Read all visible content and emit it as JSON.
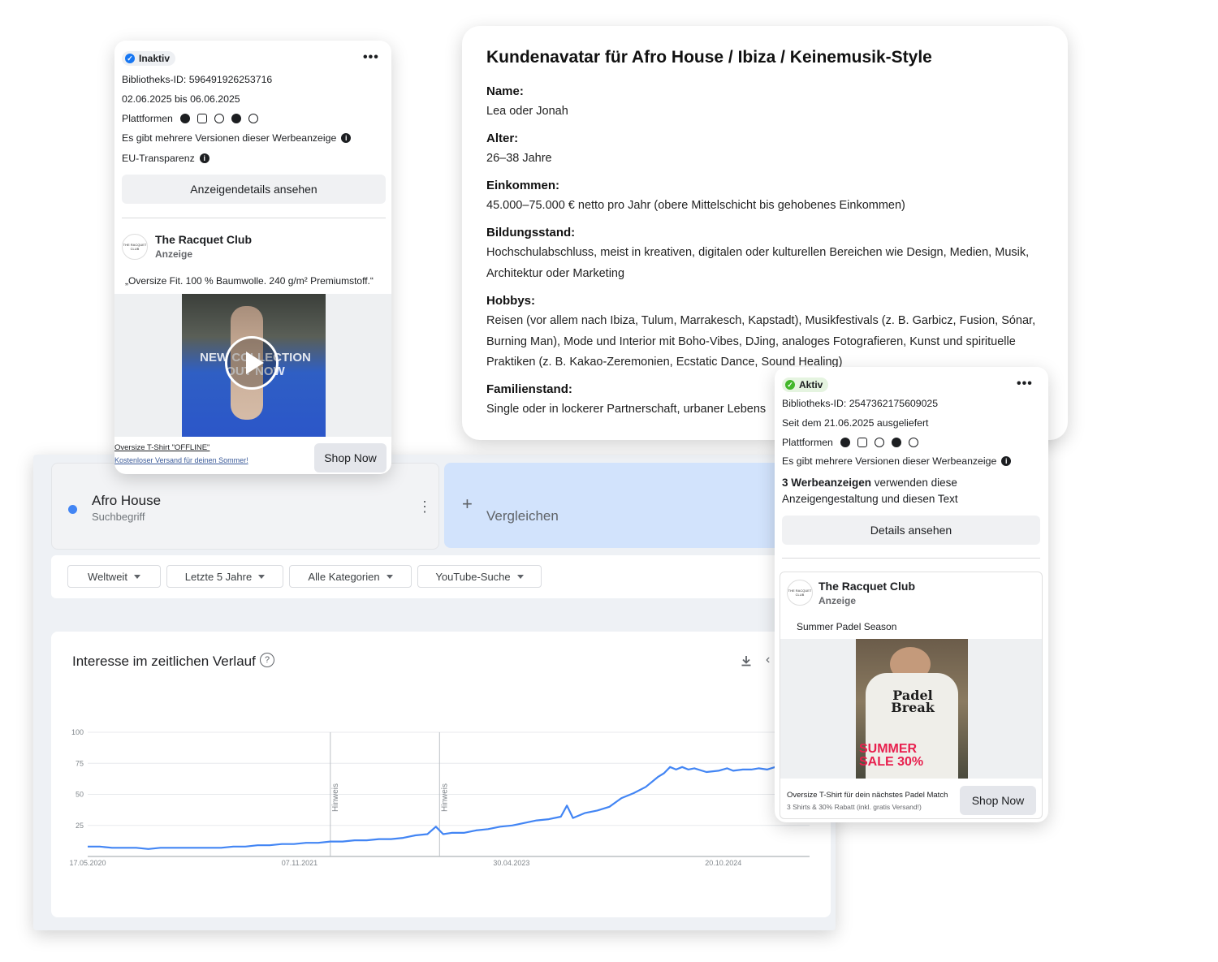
{
  "avatar": {
    "title": "Kundenavatar für Afro House / Ibiza / Keinemusik-Style",
    "fields": [
      {
        "label": "Name:",
        "text": "Lea oder Jonah"
      },
      {
        "label": "Alter:",
        "text": "26–38 Jahre"
      },
      {
        "label": "Einkommen:",
        "text": "45.000–75.000 € netto pro Jahr (obere Mittelschicht bis gehobenes Einkommen)"
      },
      {
        "label": "Bildungsstand:",
        "text": "Hochschulabschluss, meist in kreativen, digitalen oder kulturellen Bereichen wie Design, Medien, Musik, Architektur oder Marketing"
      },
      {
        "label": "Hobbys:",
        "text": "Reisen (vor allem nach Ibiza, Tulum, Marrakesch, Kapstadt), Musikfestivals (z. B. Garbicz, Fusion, Sónar, Burning Man), Mode und Interior mit Boho-Vibes, DJing, analoges Fotografieren, Kunst und spirituelle Praktiken (z. B. Kakao-Zeremonien, Ecstatic Dance, Sound Healing)"
      },
      {
        "label": "Familienstand:",
        "text": "Single oder in lockerer Partnerschaft, urbaner Lebens"
      }
    ]
  },
  "ad_inactive": {
    "status": "Inaktiv",
    "library_id": "Bibliotheks-ID: 596491926253716",
    "dates": "02.06.2025 bis 06.06.2025",
    "platforms_label": "Plattformen",
    "versions_note": "Es gibt mehrere Versionen dieser Werbeanzeige",
    "eu_label": "EU-Transparenz",
    "details_button": "Anzeigendetails ansehen",
    "brand": "The Racquet Club",
    "brand_sub": "Anzeige",
    "logo_text": "THE RACQUET CLUB",
    "copy": "„Oversize Fit. 100 % Baumwolle. 240 g/m² Premiumstoff.“",
    "video_overlay": "NEW COLLECTION OUT NOW",
    "footer_title": "Oversize T-Shirt \"OFFLINE\"",
    "footer_sub": "Kostenloser Versand für deinen Sommer!",
    "cta": "Shop Now",
    "color_status": "#1877f2"
  },
  "ad_active": {
    "status": "Aktiv",
    "library_id": "Bibliotheks-ID: 2547362175609025",
    "since": "Seit dem 21.06.2025 ausgeliefert",
    "platforms_label": "Plattformen",
    "versions_note": "Es gibt mehrere Versionen dieser Werbeanzeige",
    "usage_bold": "3 Werbeanzeigen",
    "usage_rest": " verwenden diese",
    "usage_line2": "Anzeigengestaltung und diesen Text",
    "details_button": "Details ansehen",
    "brand": "The Racquet Club",
    "brand_sub": "Anzeige",
    "logo_text": "THE RACQUET CLUB",
    "copy": "Summer Padel Season",
    "shirt_text": "Padel Break",
    "sale_text": "SUMMER SALE 30%",
    "footer_title": "Oversize T-Shirt für dein nächstes Padel Match",
    "footer_sub": "3 Shirts & 30% Rabatt (inkl. gratis Versand!)",
    "cta": "Shop Now",
    "color_status": "#42b72a"
  },
  "trends": {
    "term": "Afro House",
    "term_type": "Suchbegriff",
    "compare": "Vergleichen",
    "filters": [
      "Weltweit",
      "Letzte 5 Jahre",
      "Alle Kategorien",
      "YouTube-Suche"
    ],
    "chart_title": "Interesse im zeitlichen Verlauf",
    "line_color": "#4285f4"
  },
  "chart_data": {
    "type": "line",
    "title": "Interesse im zeitlichen Verlauf",
    "xlabel": "",
    "ylabel": "",
    "ylim": [
      0,
      100
    ],
    "y_ticks": [
      25,
      50,
      75,
      100
    ],
    "x_tick_labels": [
      "17.05.2020",
      "07.11.2021",
      "30.04.2023",
      "20.10.2024"
    ],
    "annotations": [
      {
        "label": "Hinweis",
        "x_month": 20.0
      },
      {
        "label": "Hinweis",
        "x_month": 29.0
      }
    ],
    "grid": true,
    "series": [
      {
        "name": "Afro House",
        "x_month": [
          0,
          1,
          2,
          3,
          4,
          5,
          6,
          7,
          8,
          9,
          10,
          11,
          12,
          13,
          14,
          15,
          16,
          17,
          18,
          19,
          20,
          21,
          22,
          23,
          24,
          25,
          26,
          27,
          28,
          28.7,
          29.3,
          30,
          31,
          32,
          33,
          34,
          35,
          36,
          37,
          38,
          39,
          39.5,
          40,
          41,
          42,
          43,
          44,
          45,
          46,
          47,
          47.5,
          48,
          48.5,
          49,
          49.5,
          50,
          51,
          52,
          52.7,
          53.2,
          54,
          54.7,
          55.3,
          56,
          57,
          57.5,
          58,
          58.5,
          59,
          59.5
        ],
        "values": [
          8,
          8,
          7,
          7,
          7,
          6,
          7,
          7,
          7,
          7,
          7,
          7,
          8,
          8,
          9,
          9,
          10,
          10,
          11,
          11,
          12,
          12,
          13,
          13,
          14,
          14,
          15,
          17,
          18,
          24,
          18,
          19,
          19,
          21,
          22,
          24,
          25,
          27,
          29,
          30,
          32,
          41,
          31,
          35,
          37,
          40,
          47,
          51,
          56,
          64,
          67,
          72,
          70,
          72,
          70,
          71,
          68,
          69,
          71,
          69,
          70,
          70,
          71,
          70,
          73,
          87,
          74,
          79,
          81,
          86
        ]
      }
    ]
  }
}
